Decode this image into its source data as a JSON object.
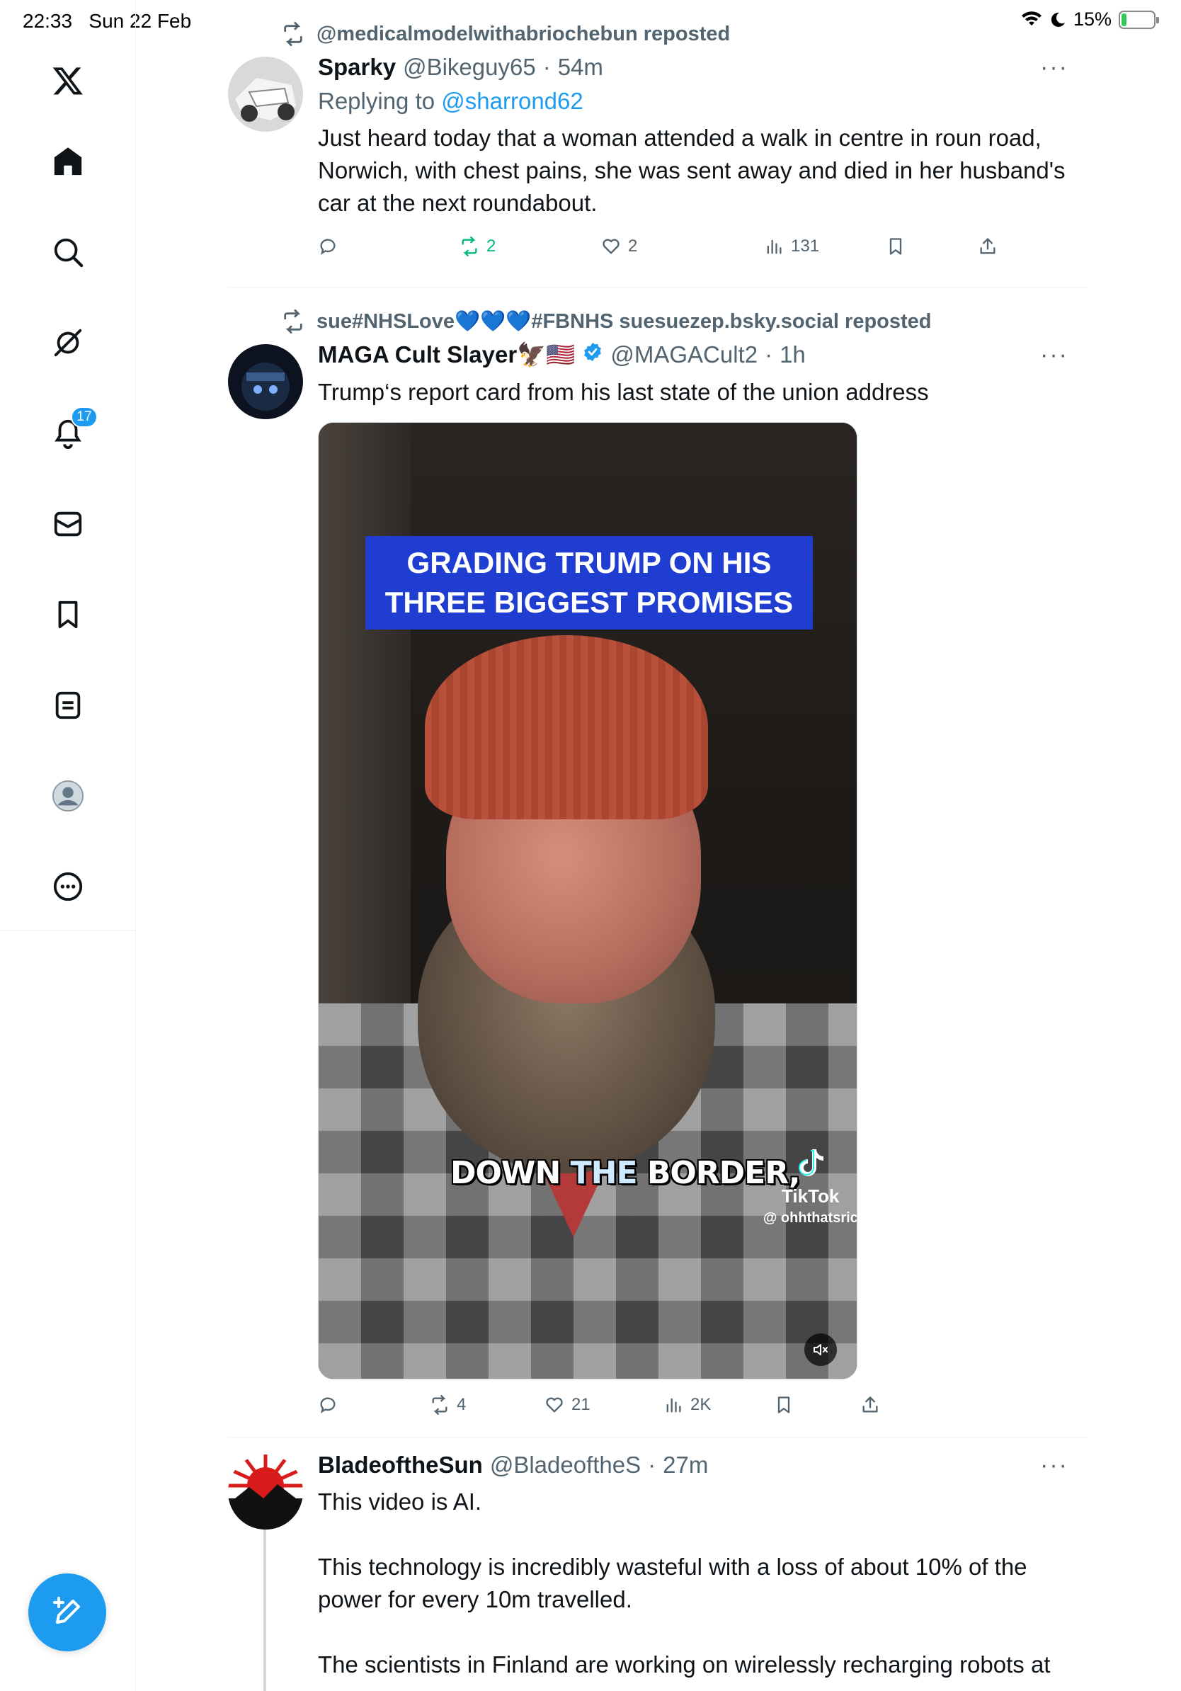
{
  "status_bar": {
    "time": "22:33",
    "date": "Sun 22 Feb",
    "battery": "15%",
    "battery_level": 0.15
  },
  "sidebar": {
    "items": [
      {
        "name": "x-logo-icon"
      },
      {
        "name": "home-icon"
      },
      {
        "name": "search-icon"
      },
      {
        "name": "grok-icon"
      },
      {
        "name": "notifications-icon",
        "badge": "17"
      },
      {
        "name": "messages-icon"
      },
      {
        "name": "bookmarks-icon"
      },
      {
        "name": "lists-icon"
      },
      {
        "name": "profile-icon"
      },
      {
        "name": "more-icon"
      }
    ],
    "compose_icon": "compose-icon"
  },
  "tweets": [
    {
      "repost_by": "@medicalmodelwithabriochebun reposted",
      "name": "Sparky",
      "handle": "@Bikeguy65",
      "time": "54m",
      "reply_prefix": "Replying to",
      "reply_to": "@sharrond62",
      "text": "Just heard today that a woman attended a walk in centre in roun road, Norwich, with chest pains, she was sent away and died in her husband's car at the next roundabout.",
      "reposts": "2",
      "likes": "2",
      "views": "131"
    },
    {
      "repost_by": "sue#NHSLove💙💙💙#FBNHS suesuezep.bsky.social reposted",
      "name": "MAGA Cult Slayer🦅🇺🇸",
      "handle": "@MAGACult2",
      "time": "1h",
      "text": "Trump‘s report card from his last state of the union address",
      "video": {
        "title": "GRADING TRUMP ON HIS THREE BIGGEST PROMISES",
        "caption_1": "DOWN ",
        "caption_2": "THE",
        "caption_3": " BORDER,",
        "platform": "TikTok",
        "user": "@ ohhthatsrich"
      },
      "reposts": "4",
      "likes": "21",
      "views": "2K"
    },
    {
      "name": "BladeoftheSun",
      "handle": "@BladeoftheS",
      "time": "27m",
      "text": "This video is AI.\n\nThis technology is incredibly wasteful with a loss of about 10% of the power for every 10m travelled.\n\nThe scientists in Finland are working on wirelessly recharging robots at"
    }
  ],
  "separator": "·",
  "more_label": "···"
}
